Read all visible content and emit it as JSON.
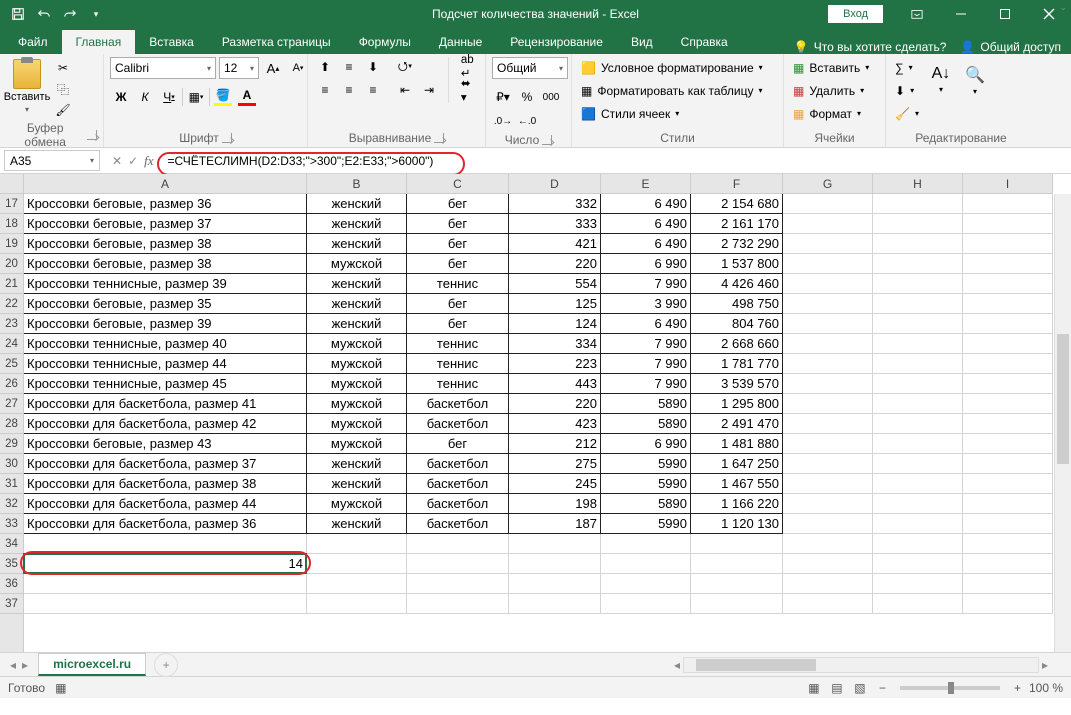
{
  "title": "Подсчет количества значений  -  Excel",
  "login": "Вход",
  "tabs": {
    "file": "Файл",
    "home": "Главная",
    "insert": "Вставка",
    "layout": "Разметка страницы",
    "formulas": "Формулы",
    "data": "Данные",
    "review": "Рецензирование",
    "view": "Вид",
    "help": "Справка"
  },
  "tell_me": "Что вы хотите сделать?",
  "share": "Общий доступ",
  "ribbon": {
    "clipboard": {
      "label": "Буфер обмена",
      "paste": "Вставить"
    },
    "font": {
      "label": "Шрифт",
      "name": "Calibri",
      "size": "12"
    },
    "alignment": {
      "label": "Выравнивание"
    },
    "number": {
      "label": "Число",
      "format": "Общий"
    },
    "styles": {
      "label": "Стили",
      "cond": "Условное форматирование",
      "table": "Форматировать как таблицу",
      "cell": "Стили ячеек"
    },
    "cells": {
      "label": "Ячейки",
      "insert": "Вставить",
      "delete": "Удалить",
      "format": "Формат"
    },
    "editing": {
      "label": "Редактирование"
    }
  },
  "name_box": "A35",
  "formula": "=СЧЁТЕСЛИМН(D2:D33;\">300\";E2:E33;\">6000\")",
  "col_widths": {
    "A": 283,
    "B": 100,
    "C": 102,
    "D": 92,
    "E": 90,
    "F": 92,
    "G": 90,
    "H": 90,
    "I": 90
  },
  "columns": [
    "A",
    "B",
    "C",
    "D",
    "E",
    "F",
    "G",
    "H",
    "I"
  ],
  "row_start": 17,
  "rows": [
    {
      "n": 17,
      "a": "Кроссовки беговые, размер 36",
      "b": "женский",
      "c": "бег",
      "d": "332",
      "e": "6 490",
      "f": "2 154 680"
    },
    {
      "n": 18,
      "a": "Кроссовки беговые, размер 37",
      "b": "женский",
      "c": "бег",
      "d": "333",
      "e": "6 490",
      "f": "2 161 170"
    },
    {
      "n": 19,
      "a": "Кроссовки беговые, размер 38",
      "b": "женский",
      "c": "бег",
      "d": "421",
      "e": "6 490",
      "f": "2 732 290"
    },
    {
      "n": 20,
      "a": "Кроссовки беговые, размер 38",
      "b": "мужской",
      "c": "бег",
      "d": "220",
      "e": "6 990",
      "f": "1 537 800"
    },
    {
      "n": 21,
      "a": "Кроссовки теннисные, размер 39",
      "b": "женский",
      "c": "теннис",
      "d": "554",
      "e": "7 990",
      "f": "4 426 460"
    },
    {
      "n": 22,
      "a": "Кроссовки беговые, размер 35",
      "b": "женский",
      "c": "бег",
      "d": "125",
      "e": "3 990",
      "f": "498 750"
    },
    {
      "n": 23,
      "a": "Кроссовки беговые, размер 39",
      "b": "женский",
      "c": "бег",
      "d": "124",
      "e": "6 490",
      "f": "804 760"
    },
    {
      "n": 24,
      "a": "Кроссовки теннисные, размер 40",
      "b": "мужской",
      "c": "теннис",
      "d": "334",
      "e": "7 990",
      "f": "2 668 660"
    },
    {
      "n": 25,
      "a": "Кроссовки теннисные, размер 44",
      "b": "мужской",
      "c": "теннис",
      "d": "223",
      "e": "7 990",
      "f": "1 781 770"
    },
    {
      "n": 26,
      "a": "Кроссовки теннисные, размер 45",
      "b": "мужской",
      "c": "теннис",
      "d": "443",
      "e": "7 990",
      "f": "3 539 570"
    },
    {
      "n": 27,
      "a": "Кроссовки для баскетбола, размер 41",
      "b": "мужской",
      "c": "баскетбол",
      "d": "220",
      "e": "5890",
      "f": "1 295 800"
    },
    {
      "n": 28,
      "a": "Кроссовки для баскетбола, размер 42",
      "b": "мужской",
      "c": "баскетбол",
      "d": "423",
      "e": "5890",
      "f": "2 491 470"
    },
    {
      "n": 29,
      "a": "Кроссовки беговые, размер 43",
      "b": "мужской",
      "c": "бег",
      "d": "212",
      "e": "6 990",
      "f": "1 481 880"
    },
    {
      "n": 30,
      "a": "Кроссовки для баскетбола, размер 37",
      "b": "женский",
      "c": "баскетбол",
      "d": "275",
      "e": "5990",
      "f": "1 647 250"
    },
    {
      "n": 31,
      "a": "Кроссовки для баскетбола, размер 38",
      "b": "женский",
      "c": "баскетбол",
      "d": "245",
      "e": "5990",
      "f": "1 467 550"
    },
    {
      "n": 32,
      "a": "Кроссовки для баскетбола, размер 44",
      "b": "мужской",
      "c": "баскетбол",
      "d": "198",
      "e": "5890",
      "f": "1 166 220"
    },
    {
      "n": 33,
      "a": "Кроссовки для баскетбола, размер 36",
      "b": "женский",
      "c": "баскетбол",
      "d": "187",
      "e": "5990",
      "f": "1 120 130"
    }
  ],
  "result_row": {
    "n": 35,
    "a": "14"
  },
  "empty_rows": [
    34,
    36,
    37
  ],
  "sheet_tab": "microexcel.ru",
  "status": "Готово",
  "zoom": "100 %",
  "add_tab": "+"
}
